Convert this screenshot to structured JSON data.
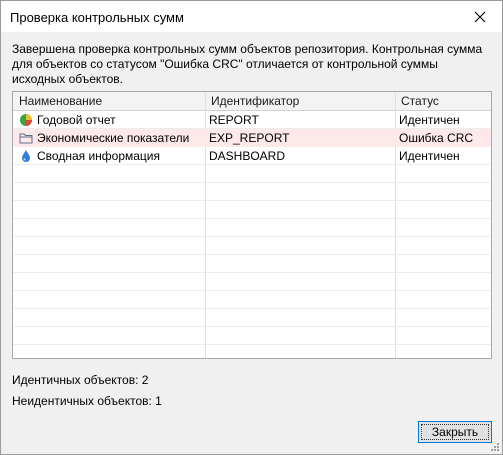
{
  "window": {
    "title": "Проверка контрольных сумм"
  },
  "message": "Завершена проверка контрольных сумм объектов репозитория. Контрольная сумма для объектов со статусом \"Ошибка CRC\" отличается от контрольной суммы исходных объектов.",
  "table": {
    "columns": [
      "Наименование",
      "Идентификатор",
      "Статус"
    ],
    "rows": [
      {
        "name": "Годовой отчет",
        "id": "REPORT",
        "status": "Идентичен",
        "icon": "pie-chart-icon"
      },
      {
        "name": "Экономические показатели",
        "id": "EXP_REPORT",
        "status": "Ошибка CRC",
        "icon": "folder-icon"
      },
      {
        "name": "Сводная информация",
        "id": "DASHBOARD",
        "status": "Идентичен",
        "icon": "drop-icon"
      }
    ]
  },
  "summary": {
    "identical": "Идентичных объектов: 2",
    "nonidentical": "Неидентичных объектов: 1"
  },
  "buttons": {
    "close": "Закрыть"
  },
  "colors": {
    "error_row": "#fde9ea",
    "button_border": "#0078d7"
  }
}
